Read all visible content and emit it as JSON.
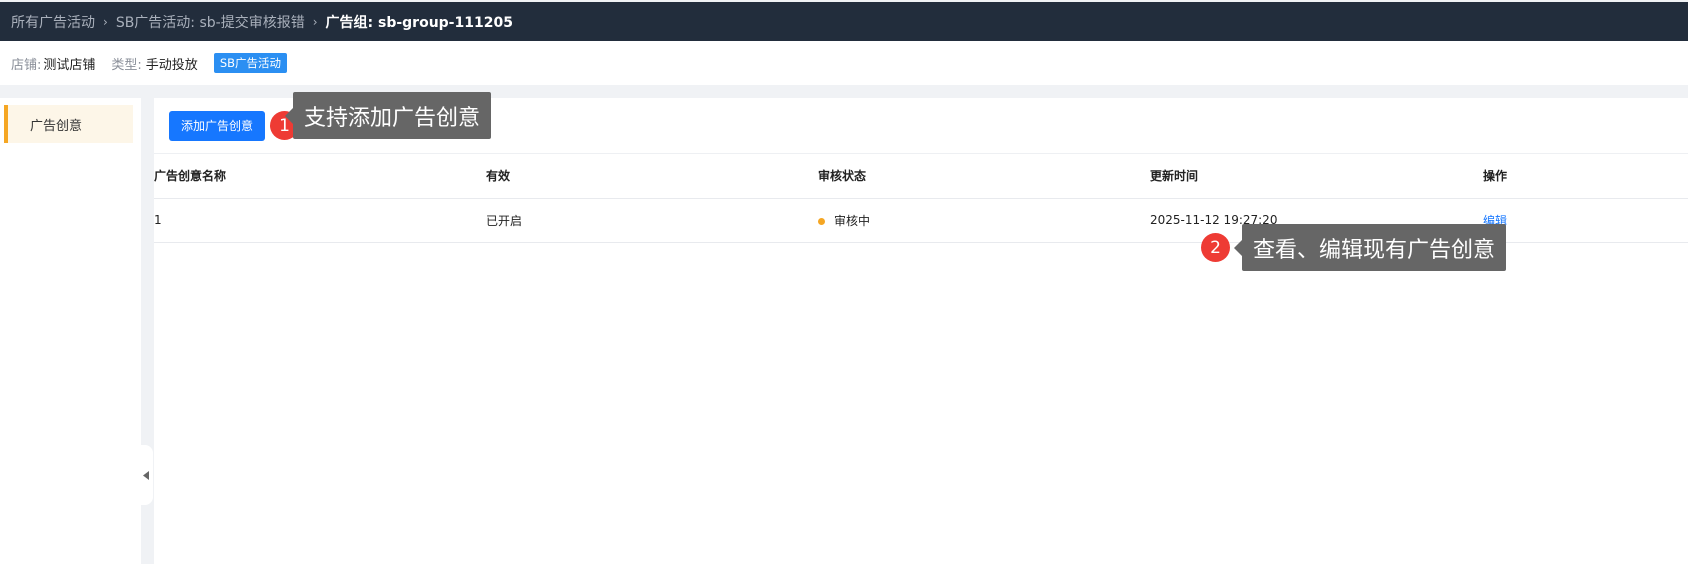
{
  "breadcrumb": {
    "items": [
      "所有广告活动",
      "SB广告活动: sb-提交审核报错"
    ],
    "current": "广告组: sb-group-111205"
  },
  "info": {
    "store_label": "店铺:",
    "store_value": "测试店铺",
    "type_label": "类型:",
    "type_value": "手动投放",
    "campaign_tag": "SB广告活动"
  },
  "sidebar": {
    "items": [
      {
        "label": "广告创意"
      }
    ]
  },
  "toolbar": {
    "add_label": "添加广告创意"
  },
  "annotations": [
    {
      "number": "1",
      "text": "支持添加广告创意"
    },
    {
      "number": "2",
      "text": "查看、编辑现有广告创意"
    }
  ],
  "table": {
    "columns": [
      "广告创意名称",
      "有效",
      "审核状态",
      "更新时间",
      "操作"
    ],
    "rows": [
      {
        "name": "1",
        "enabled": "已开启",
        "status": "审核中",
        "updated": "2025-11-12 19:27:20",
        "action": "编辑"
      }
    ]
  },
  "colors": {
    "topbar": "#222d3c",
    "primary": "#1677ff",
    "status_pending": "#f5a623",
    "marker": "#ee3b34"
  }
}
